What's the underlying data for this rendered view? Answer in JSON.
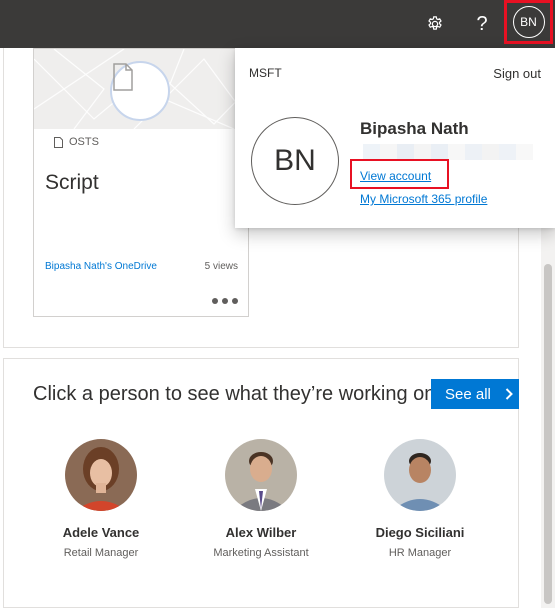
{
  "topbar": {
    "settings_icon": "gear-icon",
    "help_label": "?",
    "account_initials": "BN",
    "highlight_color": "#e81123"
  },
  "doc_card": {
    "tag": "OSTS",
    "title": "Script",
    "location": "Bipasha Nath's OneDrive",
    "views": "5 views"
  },
  "people_section": {
    "heading": "Click a person to see what they’re working on",
    "see_all_label": "See all",
    "people": [
      {
        "name": "Adele Vance",
        "role": "Retail Manager"
      },
      {
        "name": "Alex Wilber",
        "role": "Marketing Assistant"
      },
      {
        "name": "Diego Siciliani",
        "role": "HR Manager"
      }
    ]
  },
  "flyout": {
    "org": "MSFT",
    "sign_out": "Sign out",
    "initials": "BN",
    "name": "Bipasha Nath",
    "view_account": "View account",
    "profile_link": "My Microsoft 365 profile"
  },
  "colors": {
    "accent": "#0078d4",
    "topbar": "#3b3a39",
    "highlight": "#e81123"
  }
}
